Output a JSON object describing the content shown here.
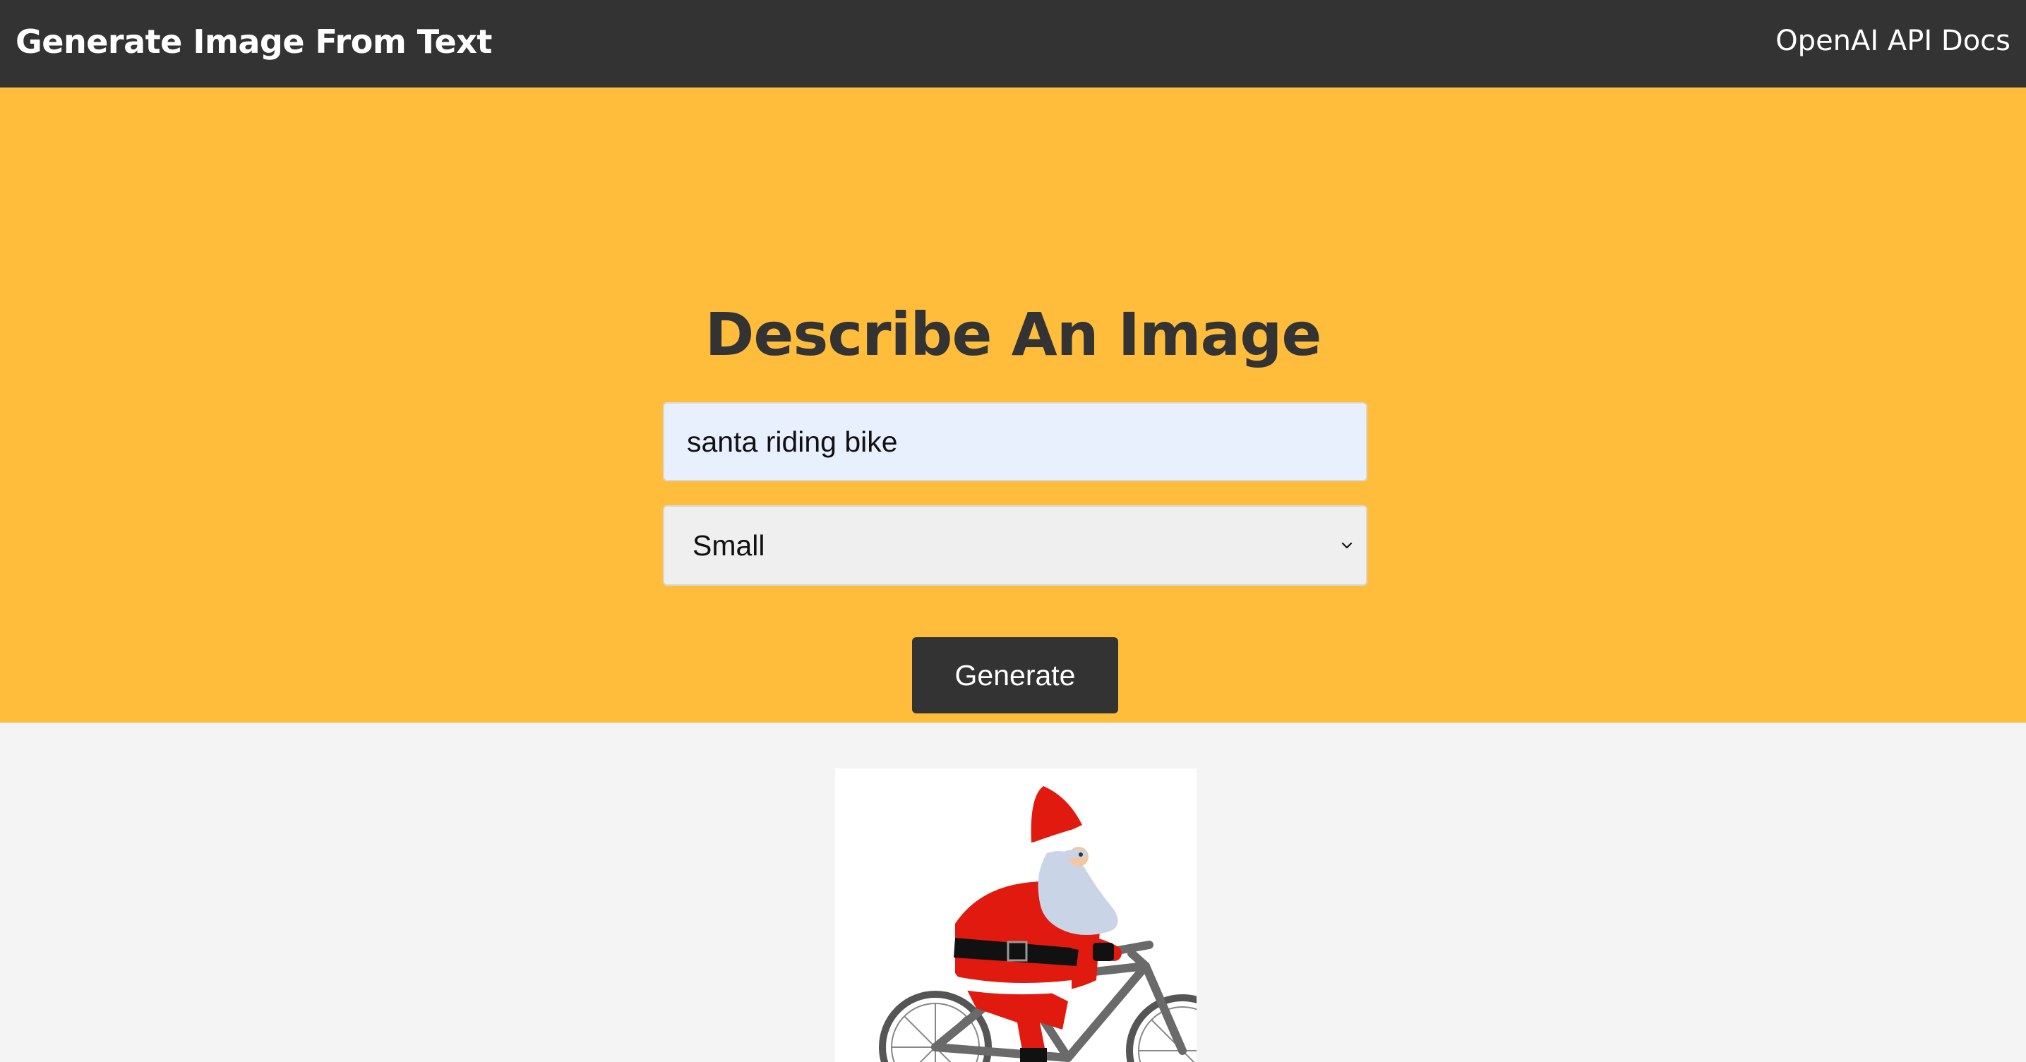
{
  "navbar": {
    "brand": "Generate Image From Text",
    "docs_link": "OpenAI API Docs"
  },
  "showcase": {
    "title": "Describe An Image",
    "prompt_value": "santa riding bike",
    "size_selected": "Small",
    "generate_label": "Generate"
  },
  "result": {
    "image_icon": "santa-riding-bike-image"
  },
  "colors": {
    "navbar_bg": "#333333",
    "showcase_bg": "#ffbd3b",
    "input_bg": "#e8f0fe",
    "select_bg": "#efefef",
    "button_bg": "#333333",
    "page_bg": "#f4f4f4"
  }
}
